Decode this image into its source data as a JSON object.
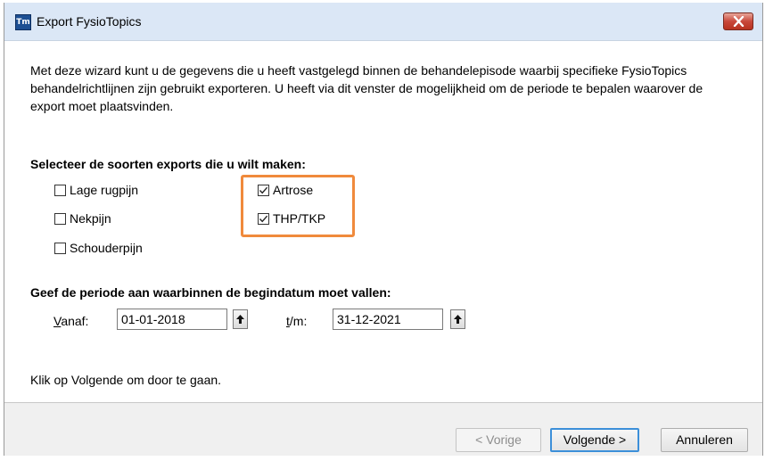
{
  "window": {
    "title": "Export FysioTopics",
    "app_icon_text": "Tm",
    "app_icon": "app-icon",
    "close_icon": "close-icon"
  },
  "intro_text": "Met deze wizard kunt u de gegevens die u heeft vastgelegd binnen de behandelepisode waarbij specifieke FysioTopics behandelrichtlijnen zijn gebruikt exporteren. U heeft via dit venster de mogelijkheid om de periode te bepalen waarover de export moet plaatsvinden.",
  "exports": {
    "title": "Selecteer de soorten exports die u wilt maken:",
    "options": [
      {
        "label": "Lage rugpijn",
        "checked": false
      },
      {
        "label": "Nekpijn",
        "checked": false
      },
      {
        "label": "Schouderpijn",
        "checked": false
      },
      {
        "label": "Artrose",
        "checked": true
      },
      {
        "label": "THP/TKP",
        "checked": true
      }
    ]
  },
  "period": {
    "title": "Geef de periode aan waarbinnen de begindatum moet vallen:",
    "from_label_underlined": "V",
    "from_label_rest": "anaf:",
    "from_value": "01-01-2018",
    "to_label_underlined": "t",
    "to_label_rest": "/m:",
    "to_value": "31-12-2021"
  },
  "hint": "Klik op Volgende om door te gaan.",
  "buttons": {
    "previous": "< Vorige",
    "next": "Volgende >",
    "cancel": "Annuleren"
  },
  "colors": {
    "highlight": "#f08a3c",
    "titlebar": "#dbe7f6",
    "close": "#c9483a",
    "default_button_border": "#3c8fd9"
  }
}
